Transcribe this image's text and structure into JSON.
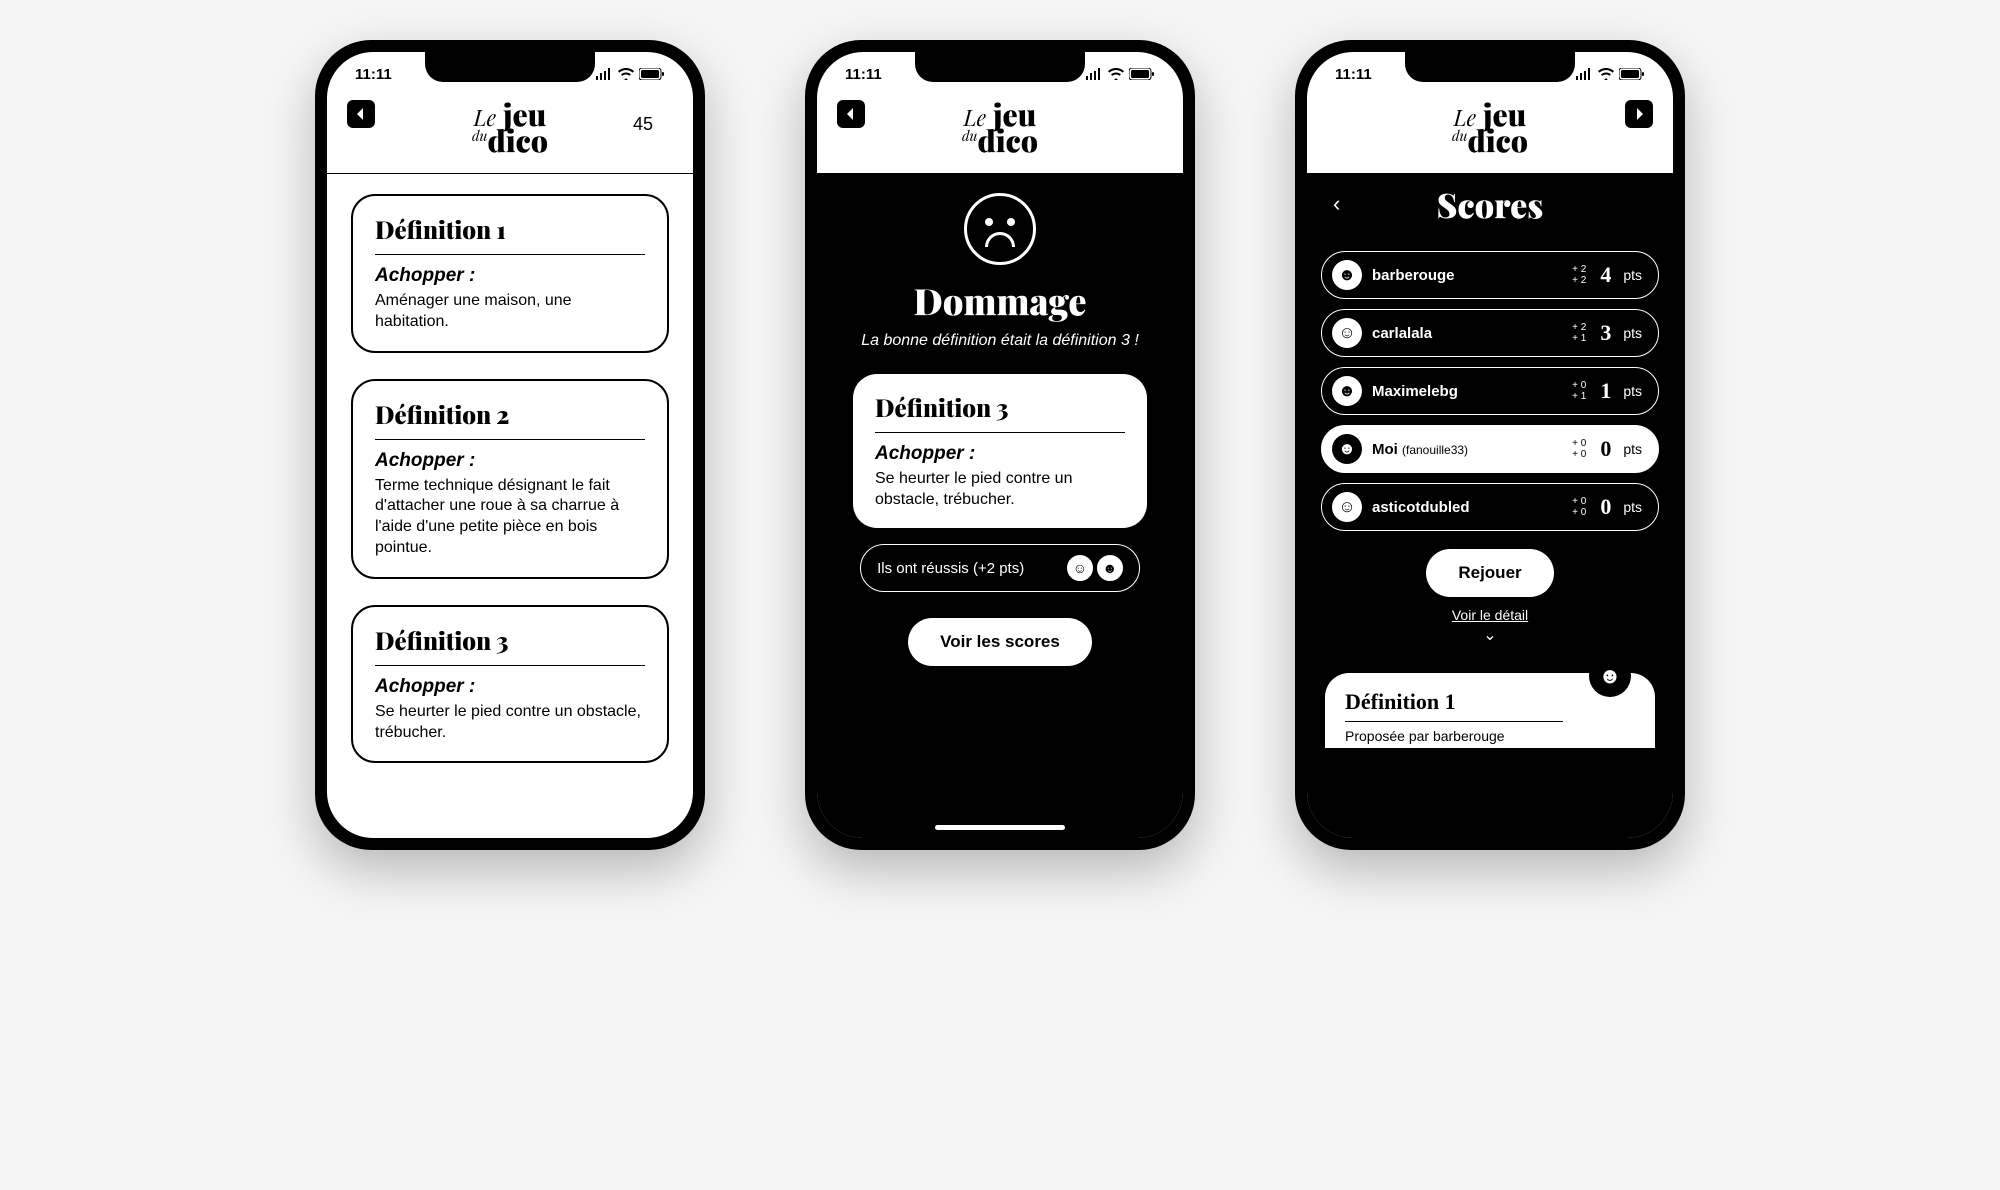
{
  "status": {
    "time": "11:11"
  },
  "app": {
    "logo_line1_le": "Le",
    "logo_line1_jeu": "jeu",
    "logo_line2_du": "du",
    "logo_line2_dico": "dico"
  },
  "screen1": {
    "timer": "45",
    "cards": [
      {
        "title": "Définition 1",
        "word": "Achopper :",
        "text": "Aménager une maison, une habitation."
      },
      {
        "title": "Définition 2",
        "word": "Achopper :",
        "text": "Terme technique désignant le fait d'attacher une roue à sa charrue à l'aide d'une petite pièce en bois pointue."
      },
      {
        "title": "Définition 3",
        "word": "Achopper :",
        "text": "Se heurter le pied contre un obstacle, trébucher."
      }
    ]
  },
  "screen2": {
    "result_title": "Dommage",
    "result_sub": "La bonne définition était la définition 3 !",
    "card": {
      "title": "Définition 3",
      "word": "Achopper :",
      "text": "Se heurter le pied contre un obstacle, trébucher."
    },
    "success_pill": "Ils ont réussis (+2 pts)",
    "scores_btn": "Voir les scores"
  },
  "screen3": {
    "title": "Scores",
    "rows": [
      {
        "name": "barberouge",
        "sub": "",
        "d1": "+ 2",
        "d2": "+ 2",
        "total": "4",
        "me": false
      },
      {
        "name": "carlalala",
        "sub": "",
        "d1": "+ 2",
        "d2": "+ 1",
        "total": "3",
        "me": false
      },
      {
        "name": "Maximelebg",
        "sub": "",
        "d1": "+ 0",
        "d2": "+ 1",
        "total": "1",
        "me": false
      },
      {
        "name": "Moi",
        "sub": "(fanouille33)",
        "d1": "+ 0",
        "d2": "+ 0",
        "total": "0",
        "me": true
      },
      {
        "name": "asticotdubled",
        "sub": "",
        "d1": "+ 0",
        "d2": "+ 0",
        "total": "0",
        "me": false
      }
    ],
    "pts_label": "pts",
    "replay_btn": "Rejouer",
    "detail_link": "Voir le détail",
    "peek": {
      "title": "Définition 1",
      "sub": "Proposée par barberouge"
    }
  }
}
